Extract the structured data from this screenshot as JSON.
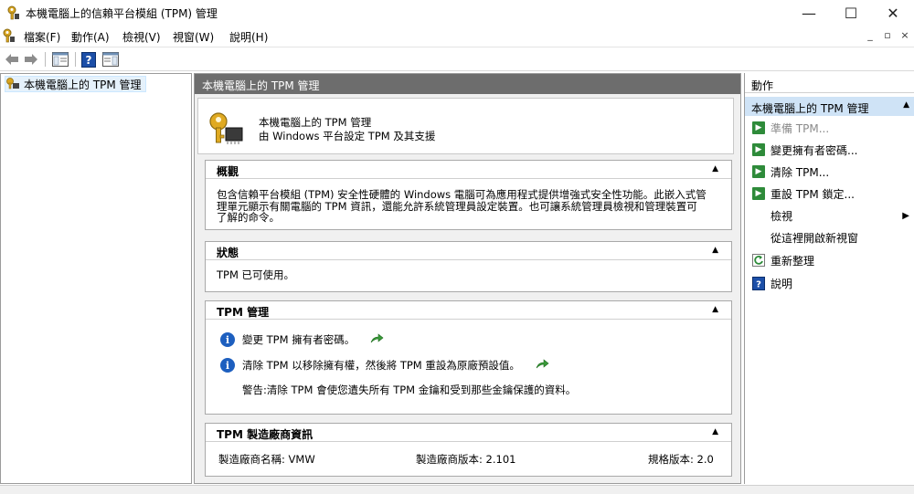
{
  "window": {
    "title": "本機電腦上的信賴平台模組 (TPM) 管理",
    "icon": "tpm-key-icon",
    "minimize": "—",
    "maximize": "☐",
    "close": "✕"
  },
  "menu": {
    "items": [
      "檔案(F)",
      "動作(A)",
      "檢視(V)",
      "視窗(W)",
      "說明(H)"
    ],
    "mdi_minimize": "_",
    "mdi_restore": "▫",
    "mdi_close": "×"
  },
  "toolbar": {
    "buttons": [
      "back-icon",
      "forward-icon",
      "show-hide-console-tree-icon",
      "help-icon",
      "show-hide-action-pane-icon"
    ]
  },
  "tree": {
    "item": "本機電腦上的 TPM 管理"
  },
  "center": {
    "header": "本機電腦上的 TPM 管理",
    "info_line1": "本機電腦上的 TPM 管理",
    "info_line2": "由 Windows 平台設定 TPM 及其支援",
    "sections": [
      {
        "title": "概觀",
        "toggle": "▲",
        "text_line1": "包含信賴平台模組 (TPM) 安全性硬體的 Windows 電腦可為應用程式提供增強式安全性功能。此嵌入式管",
        "text_line2": "理單元顯示有關電腦的 TPM 資訊，還能允許系統管理員設定裝置。也可讓系統管理員檢視和管理裝置可",
        "text_line3": "了解的命令。"
      },
      {
        "title": "狀態",
        "toggle": "▲",
        "text": "TPM 已可使用。"
      },
      {
        "title": "TPM 管理",
        "toggle": "▲",
        "item1": "變更 TPM 擁有者密碼。",
        "item2": "清除 TPM 以移除擁有權，然後將 TPM 重設為原廠預設值。",
        "warning": "警告:清除 TPM 會使您遺失所有 TPM 金鑰和受到那些金鑰保護的資料。"
      },
      {
        "title": "TPM 製造廠商資訊",
        "toggle": "▲",
        "manufacturer": "製造廠商名稱: VMW",
        "version": "製造廠商版本: 2.101",
        "spec": "規格版本: 2.0"
      }
    ]
  },
  "actions": {
    "header": "動作",
    "sub_header": "本機電腦上的 TPM 管理",
    "sub_arrow": "▲",
    "items": [
      "準備 TPM...",
      "變更擁有者密碼...",
      "清除 TPM...",
      "重設 TPM 鎖定...",
      "檢視",
      "從這裡開啟新視窗",
      "重新整理",
      "說明"
    ],
    "view_arrow": "▶"
  }
}
